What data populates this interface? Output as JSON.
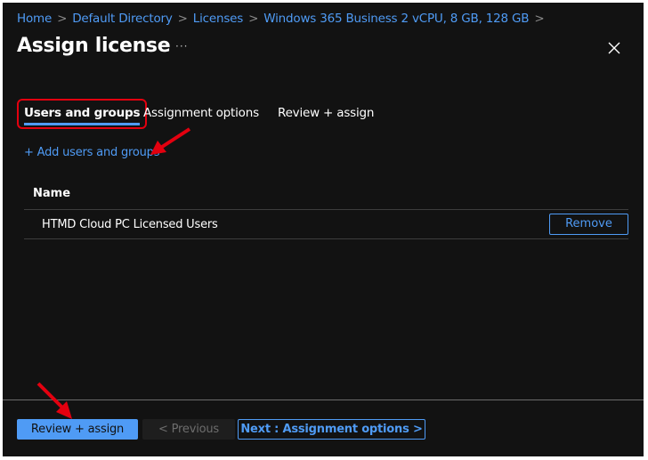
{
  "breadcrumb": [
    {
      "label": "Home"
    },
    {
      "label": "Default Directory"
    },
    {
      "label": "Licenses"
    },
    {
      "label": "Windows 365 Business 2 vCPU, 8 GB, 128 GB"
    }
  ],
  "header": {
    "title": "Assign license",
    "more_label": "···"
  },
  "tabs": [
    {
      "label": "Users and groups",
      "active": true
    },
    {
      "label": "Assignment options",
      "active": false
    },
    {
      "label": "Review + assign",
      "active": false
    }
  ],
  "add_link": "+ Add users and groups",
  "table": {
    "header": "Name",
    "rows": [
      {
        "name": "HTMD Cloud PC Licensed Users",
        "action": "Remove"
      }
    ]
  },
  "footer": {
    "review_assign": "Review + assign",
    "previous": "< Previous",
    "next": "Next : Assignment options >"
  },
  "annotations": {
    "arrow_color": "#e3000f"
  }
}
